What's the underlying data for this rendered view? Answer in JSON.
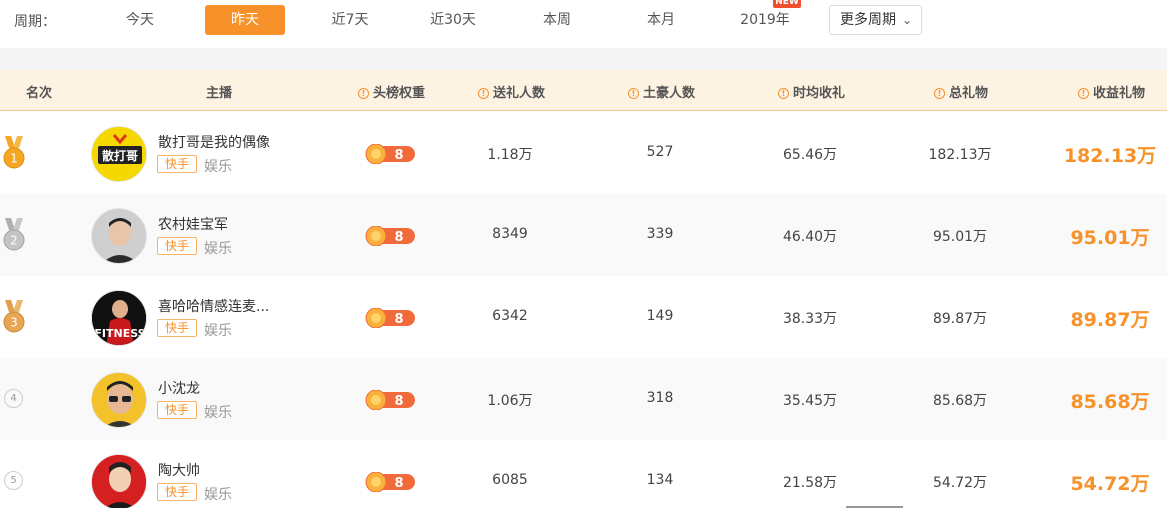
{
  "period": {
    "label": "周期：",
    "options": [
      "今天",
      "昨天",
      "近7天",
      "近30天",
      "本周",
      "本月",
      "2019年"
    ],
    "active_index": 1,
    "new_badge": "NEW",
    "more_label": "更多周期",
    "accent": "#f7912a"
  },
  "table": {
    "headers": {
      "rank": "名次",
      "anchor": "主播",
      "weight": "头榜权重",
      "givers": "送礼人数",
      "tycoons": "土豪人数",
      "hourly": "时均收礼",
      "total": "总礼物",
      "earnings": "收益礼物"
    },
    "rows": [
      {
        "rank": "1",
        "name": "散打哥是我的偶像",
        "avatar_text": "散打哥",
        "platform": "快手",
        "category": "娱乐",
        "weight": "8",
        "givers": "1.18万",
        "tycoons": "527",
        "hourly": "65.46万",
        "total": "182.13万",
        "earnings": "182.13万"
      },
      {
        "rank": "2",
        "name": "农村娃宝军",
        "avatar_text": "",
        "platform": "快手",
        "category": "娱乐",
        "weight": "8",
        "givers": "8349",
        "tycoons": "339",
        "hourly": "46.40万",
        "total": "95.01万",
        "earnings": "95.01万"
      },
      {
        "rank": "3",
        "name": "喜哈哈情感连麦...",
        "avatar_text": "FITNESS",
        "platform": "快手",
        "category": "娱乐",
        "weight": "8",
        "givers": "6342",
        "tycoons": "149",
        "hourly": "38.33万",
        "total": "89.87万",
        "earnings": "89.87万"
      },
      {
        "rank": "4",
        "name": "小沈龙",
        "avatar_text": "",
        "platform": "快手",
        "category": "娱乐",
        "weight": "8",
        "givers": "1.06万",
        "tycoons": "318",
        "hourly": "35.45万",
        "total": "85.68万",
        "earnings": "85.68万"
      },
      {
        "rank": "5",
        "name": "陶大帅",
        "avatar_text": "",
        "platform": "快手",
        "category": "娱乐",
        "weight": "8",
        "givers": "6085",
        "tycoons": "134",
        "hourly": "21.58万",
        "total": "54.72万",
        "earnings": "54.72万"
      }
    ]
  },
  "colors": {
    "gold": "#f5a623",
    "silver": "#b0b0b0",
    "bronze": "#e0a050",
    "earnings": "#f7912a"
  }
}
